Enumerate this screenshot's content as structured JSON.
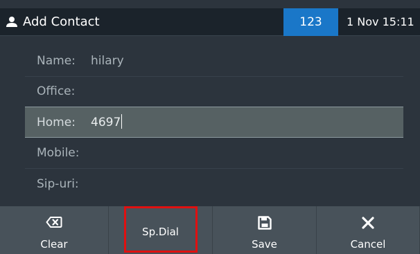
{
  "header": {
    "title": "Add Contact",
    "title_icon": "person-icon",
    "input_mode": "123",
    "input_mode_color": "#1a77c8",
    "datetime": "1 Nov 15:11"
  },
  "form": {
    "fields": [
      {
        "label": "Name:",
        "value": "hilary"
      },
      {
        "label": "Office:",
        "value": ""
      },
      {
        "label": "Home:",
        "value": "4697"
      },
      {
        "label": "Mobile:",
        "value": ""
      },
      {
        "label": "Sip-uri:",
        "value": ""
      }
    ],
    "selected_field": "Home:"
  },
  "softkeys": [
    {
      "label": "Clear",
      "icon": "backspace-icon"
    },
    {
      "label": "Sp.Dial",
      "icon": ""
    },
    {
      "label": "Save",
      "icon": "save-icon"
    },
    {
      "label": "Cancel",
      "icon": "close-icon"
    }
  ],
  "highlight_color": "#e01010"
}
